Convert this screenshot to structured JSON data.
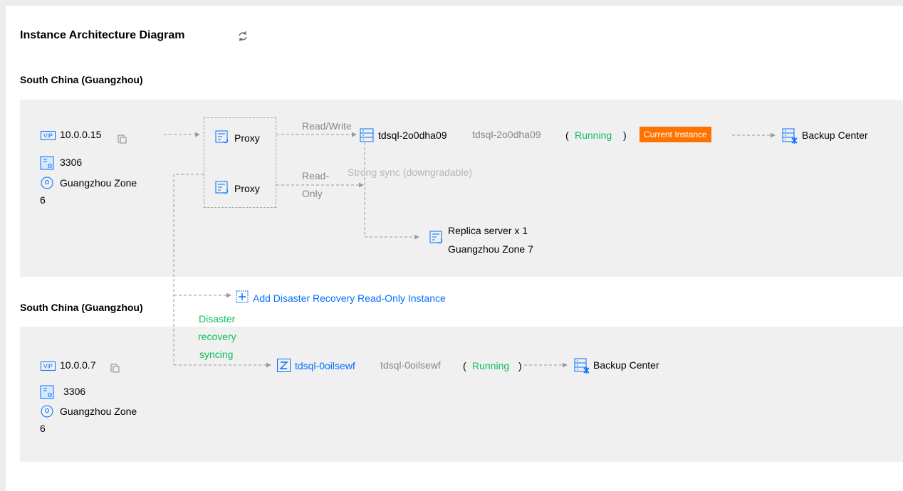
{
  "header": {
    "title": "Instance Architecture Diagram"
  },
  "primary": {
    "region": "South China (Guangzhou)",
    "vip": "10.0.0.15",
    "port": "3306",
    "zone_line1": "Guangzhou Zone",
    "zone_line2": "6",
    "proxy1": "Proxy",
    "proxy2": "Proxy",
    "read_write": "Read/Write",
    "read_only_1": "Read-",
    "read_only_2": "Only",
    "instance_id": "tdsql-2o0dha09",
    "instance_name": "tdsql-2o0dha09",
    "paren_open": "(",
    "status": "Running",
    "paren_close": ")",
    "badge": "Current Instance",
    "sync": "Strong sync (downgradable)",
    "backup": "Backup Center",
    "replica_line1": "Replica server x 1",
    "replica_line2": "Guangzhou Zone 7"
  },
  "disaster": {
    "add_label": "Add Disaster Recovery Read-Only Instance",
    "region": "South China (Guangzhou)",
    "sync_1": "Disaster",
    "sync_2": "recovery",
    "sync_3": "syncing",
    "vip": "10.0.0.7",
    "port": "3306",
    "zone_line1": "Guangzhou Zone",
    "zone_line2": "6",
    "instance_id": "tdsql-0oilsewf",
    "instance_name": "tdsql-0oilsewf",
    "paren_open": "(",
    "status": "Running",
    "paren_close": ")",
    "backup": "Backup Center"
  },
  "colors": {
    "accent": "#006eff",
    "running": "#0abf5b",
    "current_badge": "#ff7200",
    "panel": "#f0f0f0"
  },
  "icons": [
    "refresh-icon",
    "vip-icon",
    "copy-icon",
    "port-icon",
    "location-icon",
    "proxy-icon",
    "server-icon",
    "replica-icon",
    "backup-icon",
    "add-icon",
    "z-instance-icon"
  ]
}
